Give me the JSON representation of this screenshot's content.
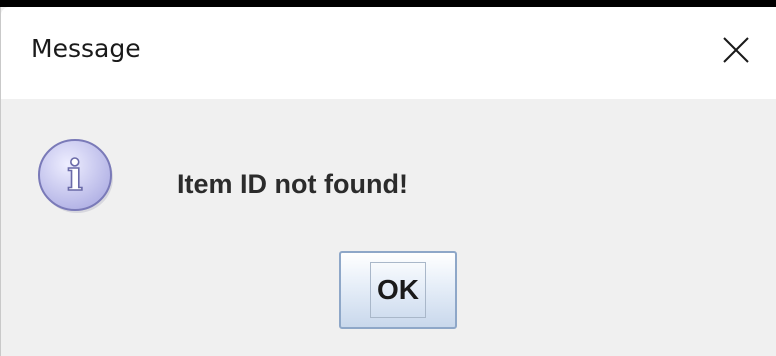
{
  "window": {
    "title": "Message",
    "close_icon": "close-icon"
  },
  "dialog": {
    "icon": "info-icon",
    "icon_glyph": "i",
    "message": "Item ID not found!",
    "ok_label": "OK"
  },
  "colors": {
    "icon_fill": "#c8c8f0",
    "icon_stroke": "#7a7ab8",
    "button_border": "#8ea7c8",
    "dialog_bg": "#f0f0f0"
  }
}
